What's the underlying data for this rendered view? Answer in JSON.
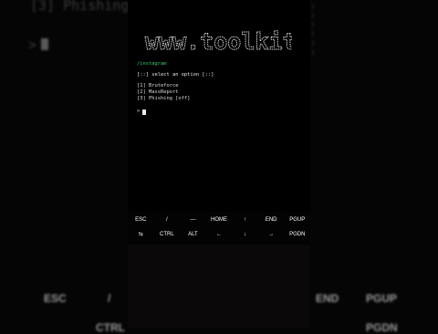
{
  "background": {
    "top_text": "[3] Phishing [o",
    "prompt_symbol": ">",
    "keys": [
      "ESC",
      "/",
      "END",
      "PGUP",
      "CTRL",
      "PGDN"
    ]
  },
  "terminal": {
    "logo_text": "www.toolkit",
    "tag": "/instagram",
    "prompt": "[::] select an option [::]",
    "menu": [
      "[1] Bruteforce",
      "[2] MassReport",
      "[3] Phishing [off]"
    ],
    "input_prompt": ">",
    "colors": {
      "tag": "#2ecc71",
      "text": "#e8e8e8",
      "background": "#000000"
    }
  },
  "extra_keys": {
    "row1": [
      "ESC",
      "/",
      "—",
      "HOME",
      "↑",
      "END",
      "PGUP"
    ],
    "row2": [
      "⇆",
      "CTRL",
      "ALT",
      "←",
      "↓",
      "→",
      "PGDN"
    ]
  }
}
